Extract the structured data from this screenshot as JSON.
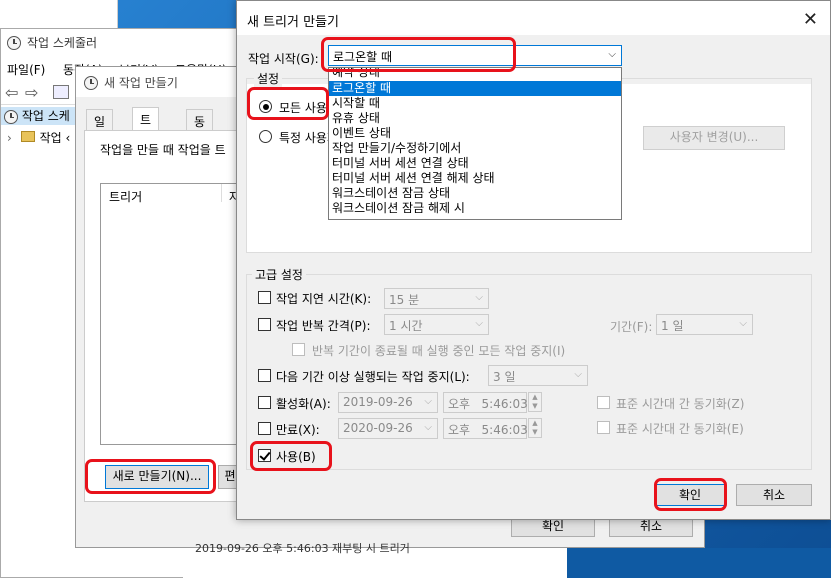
{
  "scheduler": {
    "title": "작업 스케줄러",
    "menu": [
      "파일(F)",
      "동작(A)",
      "보기(V)",
      "도움말(H)"
    ],
    "tree": [
      "작업 스케",
      "작업 ‹"
    ]
  },
  "new_task": {
    "title": "새 작업 만들기",
    "tabs": [
      "일반",
      "트리거",
      "동작"
    ],
    "description": "작업을 만들 때 작업을 트",
    "list_header": "트리거",
    "list_header2": "자",
    "new_button": "새로 만들기(N)...",
    "edit_button": "편",
    "ok_button": "확인",
    "cancel_button": "취소",
    "bottom_text": "2019-09-26 오후 5:46:03 재부팅 시 트리거"
  },
  "dialog": {
    "title": "새 트리거 만들기",
    "begin_label": "작업 시작(G):",
    "begin_value": "로그온할 때",
    "dropdown_options": [
      "예약 상태",
      "로그온할 때",
      "시작할 때",
      "유휴 상태",
      "이벤트 상태",
      "작업 만들기/수정하기에서",
      "터미널 서버 세션 연결 상태",
      "터미널 서버 세션 연결 해제 상태",
      "워크스테이션 잠금 상태",
      "워크스테이션 잠금 해제 시"
    ],
    "settings_label": "설정",
    "radio_any_user": "모든 사용자",
    "radio_specific_user": "특정 사용자",
    "change_user_button": "사용자 변경(U)...",
    "advanced_label": "고급 설정",
    "delay_label": "작업 지연 시간(K):",
    "delay_value": "15 분",
    "repeat_label": "작업 반복 간격(P):",
    "repeat_value": "1 시간",
    "duration_label": "기간(F):",
    "duration_value": "1 일",
    "stop_repeat_label": "반복 기간이 종료될 때 실행 중인 모든 작업 중지(I)",
    "stop_longer_label": "다음 기간 이상 실행되는 작업 중지(L):",
    "stop_longer_value": "3 일",
    "activate_label": "활성화(A):",
    "activate_date": "2019-09-26",
    "activate_time": "오후   5:46:03",
    "sync_tz_label_1": "표준 시간대 간 동기화(Z)",
    "expire_label": "만료(X):",
    "expire_date": "2020-09-26",
    "expire_time": "오후   5:46:03",
    "sync_tz_label_2": "표준 시간대 간 동기화(E)",
    "enabled_label": "사용(B)",
    "ok_button": "확인",
    "cancel_button": "취소"
  },
  "colors": {
    "highlight": "#0078d7",
    "annotation_red": "#e8121b"
  }
}
